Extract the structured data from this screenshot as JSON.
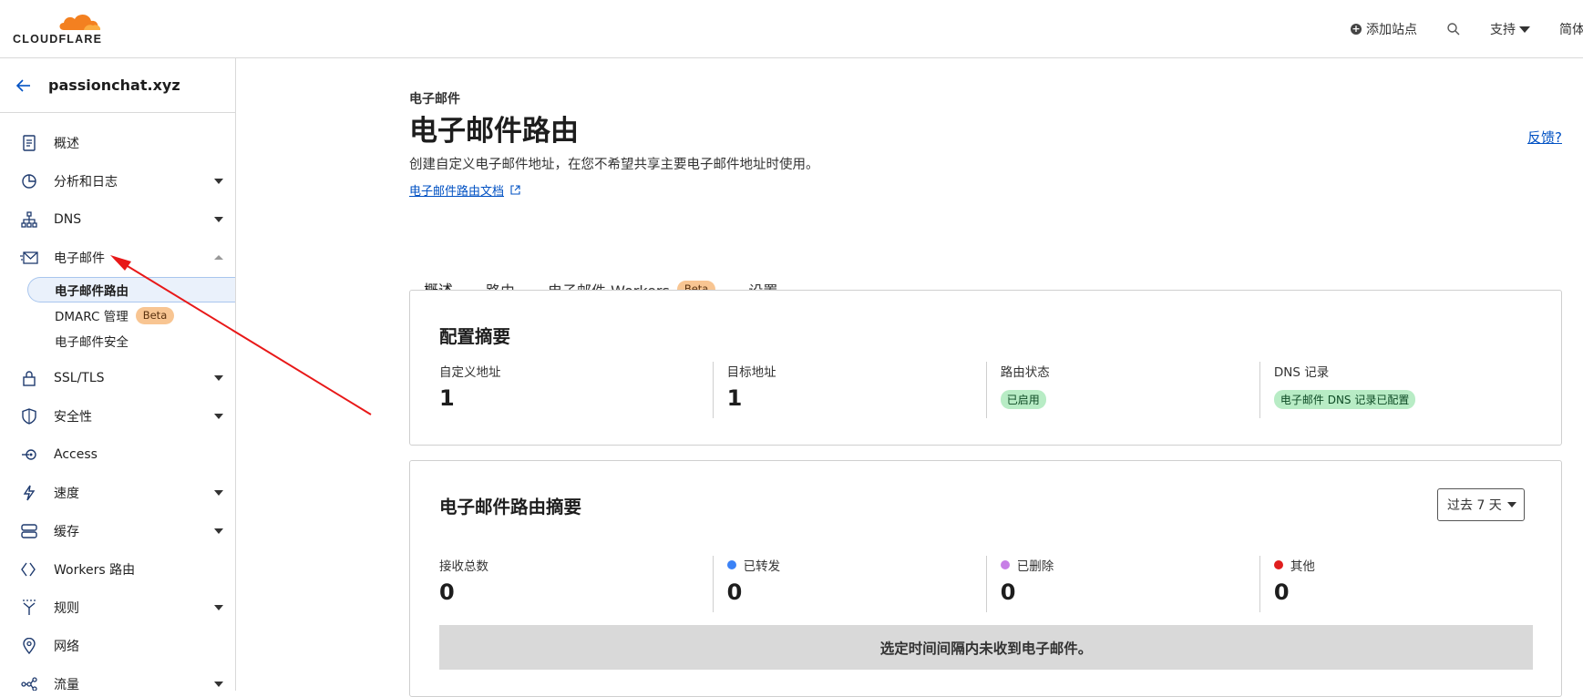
{
  "brand": {
    "logo_text": "CLOUDFLARE",
    "accent": "#f38020",
    "link": "#0051c3"
  },
  "topbar": {
    "add_site_label": "添加站点",
    "support_label": "支持",
    "language_label": "简体中文"
  },
  "sidebar": {
    "zone_name": "passionchat.xyz",
    "items": [
      {
        "label": "概述",
        "icon": "document-icon",
        "dropdown": false
      },
      {
        "label": "分析和日志",
        "icon": "clock-chart-icon",
        "dropdown": true
      },
      {
        "label": "DNS",
        "icon": "network-icon",
        "dropdown": true
      },
      {
        "label": "电子邮件",
        "icon": "mail-icon",
        "dropdown": "open",
        "sub_items": [
          {
            "label": "电子邮件路由",
            "active": true
          },
          {
            "label": "DMARC 管理",
            "badge": "Beta"
          },
          {
            "label": "电子邮件安全"
          }
        ]
      },
      {
        "label": "SSL/TLS",
        "icon": "lock-icon",
        "dropdown": true
      },
      {
        "label": "安全性",
        "icon": "shield-icon",
        "dropdown": true
      },
      {
        "label": "Access",
        "icon": "access-icon",
        "dropdown": false
      },
      {
        "label": "速度",
        "icon": "bolt-icon",
        "dropdown": true
      },
      {
        "label": "缓存",
        "icon": "server-icon",
        "dropdown": true
      },
      {
        "label": "Workers 路由",
        "icon": "workers-icon",
        "dropdown": false
      },
      {
        "label": "规则",
        "icon": "rules-icon",
        "dropdown": true
      },
      {
        "label": "网络",
        "icon": "location-icon",
        "dropdown": false
      },
      {
        "label": "流量",
        "icon": "traffic-icon",
        "dropdown": true
      }
    ]
  },
  "page": {
    "breadcrumb": "电子邮件",
    "title": "电子邮件路由",
    "description": "创建自定义电子邮件地址，在您不希望共享主要电子邮件地址时使用。",
    "doc_link": "电子邮件路由文档",
    "feedback": "反馈?",
    "tabs": [
      {
        "label": "概述",
        "active": true
      },
      {
        "label": "路由"
      },
      {
        "label": "电子邮件 Workers",
        "badge": "Beta"
      },
      {
        "label": "设置"
      }
    ]
  },
  "config_summary": {
    "title": "配置摘要",
    "custom_address_label": "自定义地址",
    "custom_address_value": "1",
    "target_address_label": "目标地址",
    "target_address_value": "1",
    "routing_status_label": "路由状态",
    "routing_status_value": "已启用",
    "dns_label": "DNS 记录",
    "dns_value": "电子邮件 DNS 记录已配置"
  },
  "routing_summary": {
    "title": "电子邮件路由摘要",
    "range_select": "过去 7 天",
    "received_label": "接收总数",
    "received_value": "0",
    "forwarded_label": "已转发",
    "forwarded_value": "0",
    "forwarded_color": "#3b82f6",
    "deleted_label": "已删除",
    "deleted_value": "0",
    "deleted_color": "#c77ee6",
    "other_label": "其他",
    "other_value": "0",
    "other_color": "#e01e1e",
    "empty_message": "选定时间间隔内未收到电子邮件。"
  },
  "annotation": {
    "arrow_color": "#e81818"
  }
}
